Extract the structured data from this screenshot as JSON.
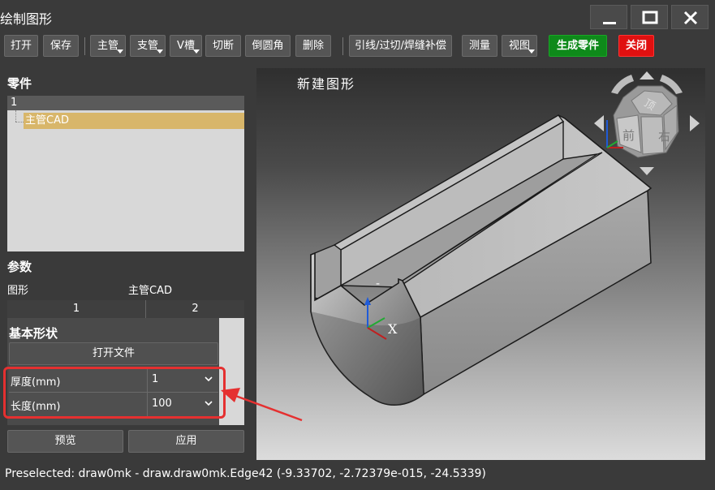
{
  "window": {
    "title": "绘制图形"
  },
  "toolbar": {
    "open": "打开",
    "save": "保存",
    "main_pipe": "主管",
    "branch_pipe": "支管",
    "v_groove": "V槽",
    "cut": "切断",
    "fillet": "倒圆角",
    "delete": "删除",
    "lead": "引线/过切/焊缝补偿",
    "measure": "测量",
    "view": "视图",
    "generate": "生成零件",
    "close": "关闭"
  },
  "parts": {
    "heading": "零件",
    "tree_header": "1",
    "selected_item": "主管CAD"
  },
  "params": {
    "heading": "参数",
    "shape_label": "图形",
    "shape_value": "主管CAD",
    "tabs": [
      "1",
      "2"
    ]
  },
  "basic": {
    "title": "基本形状",
    "open_file": "打开文件",
    "rows": [
      {
        "label": "厚度(mm)",
        "value": "1"
      },
      {
        "label": "长度(mm)",
        "value": "100"
      }
    ]
  },
  "actions": {
    "preview": "预览",
    "apply": "应用"
  },
  "viewport": {
    "title": "新建图形",
    "axis_x": "X",
    "axis_label_dash": "-",
    "cube_top": "顶",
    "cube_front": "前",
    "cube_right": "右"
  },
  "status": "Preselected: draw0mk - draw.draw0mk.Edge42 (-9.33702, -2.72379e-015, -24.5339)",
  "colors": {
    "accent_green": "#0e8a1a",
    "accent_red": "#e01010",
    "selection": "#d8b66a",
    "annotation": "#e53030"
  }
}
